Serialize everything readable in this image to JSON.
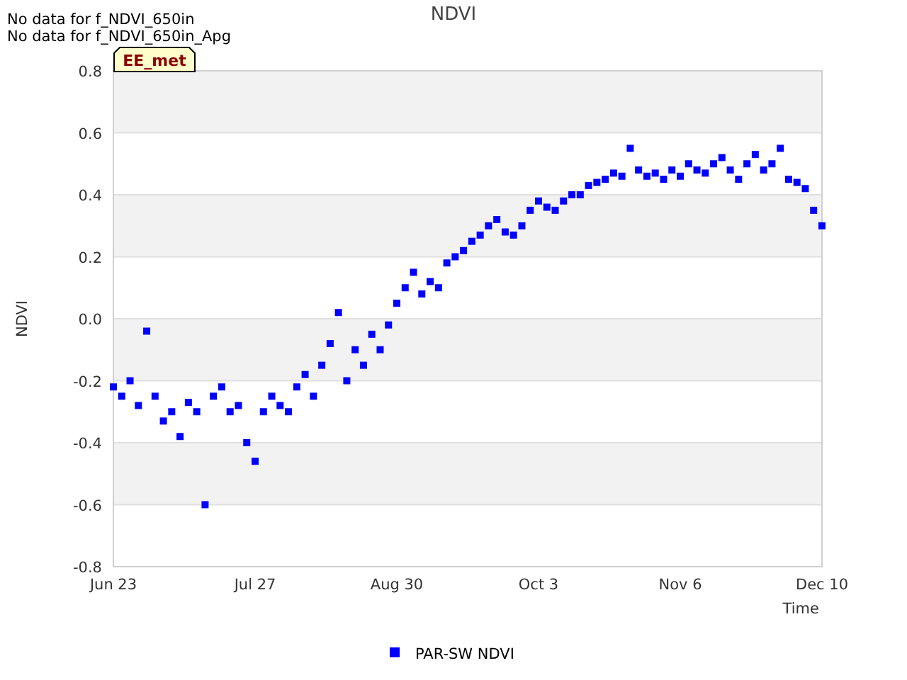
{
  "notes": [
    "No data for f_NDVI_650in",
    "No data for f_NDVI_650in_Apg"
  ],
  "station_tag": "EE_met",
  "chart_data": {
    "type": "scatter",
    "title": "NDVI",
    "xlabel": "Time",
    "ylabel": "NDVI",
    "categories": [
      "Jun 23",
      null,
      null,
      null,
      null,
      null,
      null,
      null,
      null,
      null,
      null,
      null,
      null,
      null,
      null,
      null,
      null,
      "Jul 27",
      null,
      null,
      null,
      null,
      null,
      null,
      null,
      null,
      null,
      null,
      null,
      null,
      null,
      null,
      null,
      null,
      "Aug 30",
      null,
      null,
      null,
      null,
      null,
      null,
      null,
      null,
      null,
      null,
      null,
      null,
      null,
      null,
      null,
      null,
      "Oct 3",
      null,
      null,
      null,
      null,
      null,
      null,
      null,
      null,
      null,
      null,
      null,
      null,
      null,
      null,
      null,
      null,
      "Nov 6",
      null,
      null,
      null,
      null,
      null,
      null,
      null,
      null,
      null,
      null,
      null,
      null,
      null,
      null,
      null,
      null,
      "Dec 10"
    ],
    "series": [
      {
        "name": "PAR-SW NDVI",
        "color": "#0000ff",
        "values": [
          -0.22,
          -0.25,
          -0.2,
          -0.28,
          -0.04,
          -0.25,
          -0.33,
          -0.3,
          -0.38,
          -0.27,
          -0.3,
          -0.6,
          -0.25,
          -0.22,
          -0.3,
          -0.28,
          -0.4,
          -0.46,
          -0.3,
          -0.25,
          -0.28,
          -0.3,
          -0.22,
          -0.18,
          -0.25,
          -0.15,
          -0.08,
          0.02,
          -0.2,
          -0.1,
          -0.15,
          -0.05,
          -0.1,
          -0.02,
          0.05,
          0.1,
          0.15,
          0.08,
          0.12,
          0.1,
          0.18,
          0.2,
          0.22,
          0.25,
          0.27,
          0.3,
          0.32,
          0.28,
          0.27,
          0.3,
          0.35,
          0.38,
          0.36,
          0.35,
          0.38,
          0.4,
          0.4,
          0.43,
          0.44,
          0.45,
          0.47,
          0.46,
          0.55,
          0.48,
          0.46,
          0.47,
          0.45,
          0.48,
          0.46,
          0.5,
          0.48,
          0.47,
          0.5,
          0.52,
          0.48,
          0.45,
          0.5,
          0.53,
          0.48,
          0.5,
          0.55,
          0.45,
          0.44,
          0.42,
          0.35,
          0.3
        ]
      }
    ],
    "grid": true,
    "ylim": [
      -0.8,
      0.8
    ],
    "yticks": [
      {
        "value": 0.8,
        "label": "0.8"
      },
      {
        "value": 0.6,
        "label": "0.6"
      },
      {
        "value": 0.4,
        "label": "0.4"
      },
      {
        "value": 0.2,
        "label": "0.2"
      },
      {
        "value": 0,
        "label": "0.0"
      },
      {
        "value": -0.2,
        "label": "-0.2"
      },
      {
        "value": -0.4,
        "label": "-0.4"
      },
      {
        "value": -0.6,
        "label": "-0.6"
      },
      {
        "value": -0.8,
        "label": "-0.8"
      }
    ]
  }
}
